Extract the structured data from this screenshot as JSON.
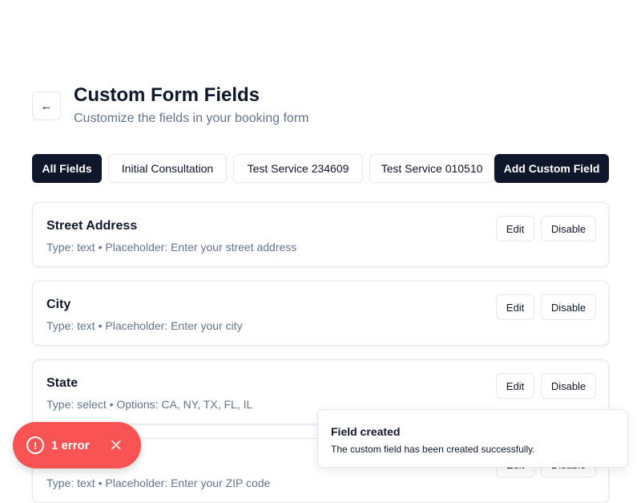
{
  "header": {
    "title": "Custom Form Fields",
    "subtitle": "Customize the fields in your booking form"
  },
  "tabs": [
    {
      "label": "All Fields"
    },
    {
      "label": "Initial Consultation"
    },
    {
      "label": "Test Service 234609"
    },
    {
      "label": "Test Service 010510"
    }
  ],
  "add_button": "Add Custom Field",
  "fields": [
    {
      "name": "Street Address",
      "desc": "Type: text • Placeholder: Enter your street address"
    },
    {
      "name": "City",
      "desc": "Type: text • Placeholder: Enter your city"
    },
    {
      "name": "State",
      "desc": "Type: select • Options: CA, NY, TX, FL, IL"
    },
    {
      "name": "",
      "desc": "Type: text • Placeholder: Enter your ZIP code"
    }
  ],
  "actions": {
    "edit": "Edit",
    "disable": "Disable"
  },
  "toast": {
    "title": "Field created",
    "message": "The custom field has been created successfully."
  },
  "error_badge": {
    "label": "1 error"
  }
}
